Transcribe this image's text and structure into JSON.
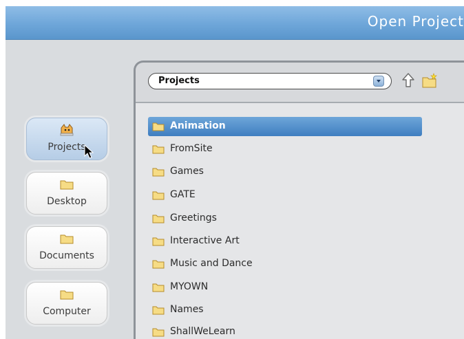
{
  "window": {
    "title": "Open Project"
  },
  "sidebar": {
    "items": [
      {
        "label": "Projects",
        "icon": "projects-cat-icon",
        "selected": true
      },
      {
        "label": "Desktop",
        "icon": "folder-icon",
        "selected": false
      },
      {
        "label": "Documents",
        "icon": "folder-icon",
        "selected": false
      },
      {
        "label": "Computer",
        "icon": "folder-icon",
        "selected": false
      }
    ]
  },
  "toolbar": {
    "location_value": "Projects",
    "up_icon": "up-arrow-icon",
    "new_folder_icon": "new-folder-icon"
  },
  "files": {
    "items": [
      {
        "label": "Animation",
        "selected": true
      },
      {
        "label": "FromSite",
        "selected": false
      },
      {
        "label": "Games",
        "selected": false
      },
      {
        "label": "GATE",
        "selected": false
      },
      {
        "label": "Greetings",
        "selected": false
      },
      {
        "label": "Interactive Art",
        "selected": false
      },
      {
        "label": "Music and Dance",
        "selected": false
      },
      {
        "label": "MYOWN",
        "selected": false
      },
      {
        "label": "Names",
        "selected": false
      },
      {
        "label": "ShallWeLearn",
        "selected": false
      }
    ]
  },
  "colors": {
    "accent": "#5a96cc",
    "selection": "#3f7ec0",
    "folder": "#f2d36b"
  }
}
